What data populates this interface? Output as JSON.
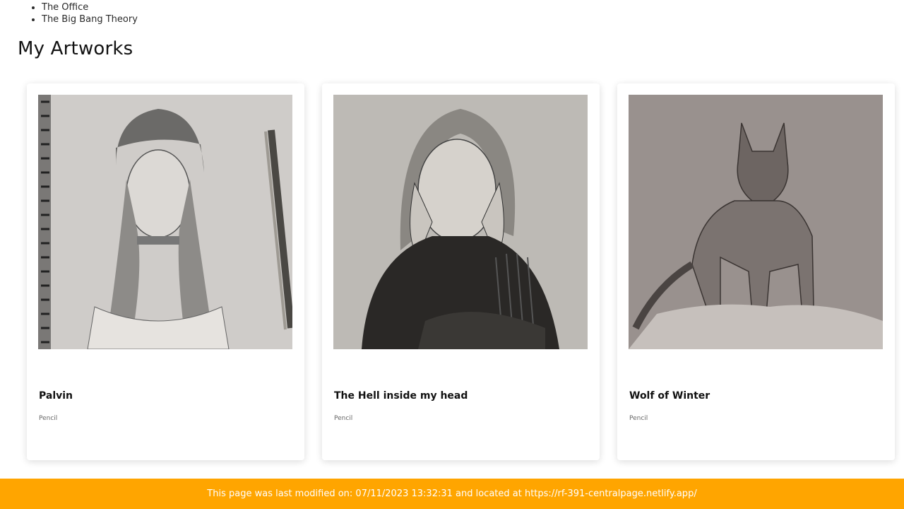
{
  "shows": [
    "The Office",
    "The Big Bang Theory"
  ],
  "artworks_section": {
    "title": "My Artworks",
    "cards": [
      {
        "title": "Palvin",
        "medium": "Pencil"
      },
      {
        "title": "The Hell inside my head",
        "medium": "Pencil"
      },
      {
        "title": "Wolf of Winter",
        "medium": "Pencil"
      }
    ]
  },
  "footer": {
    "text": "This page was last modified on: 07/11/2023 13:32:31 and located at https://rf-391-centralpage.netlify.app/"
  },
  "colors": {
    "footer_bg": "#ffa500",
    "footer_text": "#ffffff",
    "card_shadow": "rgba(0,0,0,0.14)"
  }
}
